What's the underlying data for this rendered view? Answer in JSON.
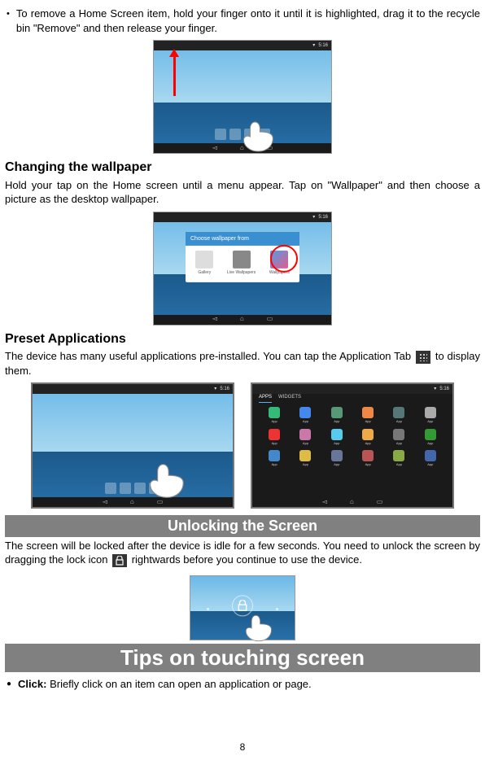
{
  "intro": {
    "remove_item_text": "To remove a Home Screen item, hold your finger onto it until it is highlighted, drag it to the recycle bin \"Remove\" and then release your finger."
  },
  "wallpaper": {
    "heading": "Changing the wallpaper",
    "text": "Hold your tap on the Home screen until a menu appear. Tap on \"Wallpaper\" and then choose a picture as the desktop wallpaper.",
    "dialog_title": "Choose wallpaper from",
    "options": [
      "Gallery",
      "Live Wallpapers",
      "Wallpapers"
    ]
  },
  "preset": {
    "heading": "Preset Applications",
    "text_before": "The device has many useful applications pre-installed. You can tap the Application Tab ",
    "text_after": " to display them.",
    "apps_tab_labels": [
      "APPS",
      "WIDGETS"
    ]
  },
  "unlocking": {
    "banner": "Unlocking the Screen",
    "text_before": "The screen will be locked after the device is idle for a few seconds. You need to unlock the screen by dragging the lock icon ",
    "text_after": " rightwards before you continue to use the device."
  },
  "tips": {
    "banner": "Tips on touching screen",
    "click_label": "Click:",
    "click_text": " Briefly click on an item can open an application or page."
  },
  "page_number": "8",
  "status_time": "5:16",
  "colors": {
    "banner_bg": "#808080",
    "accent_red": "#FF0000",
    "accent_blue": "#3A8FD0"
  }
}
